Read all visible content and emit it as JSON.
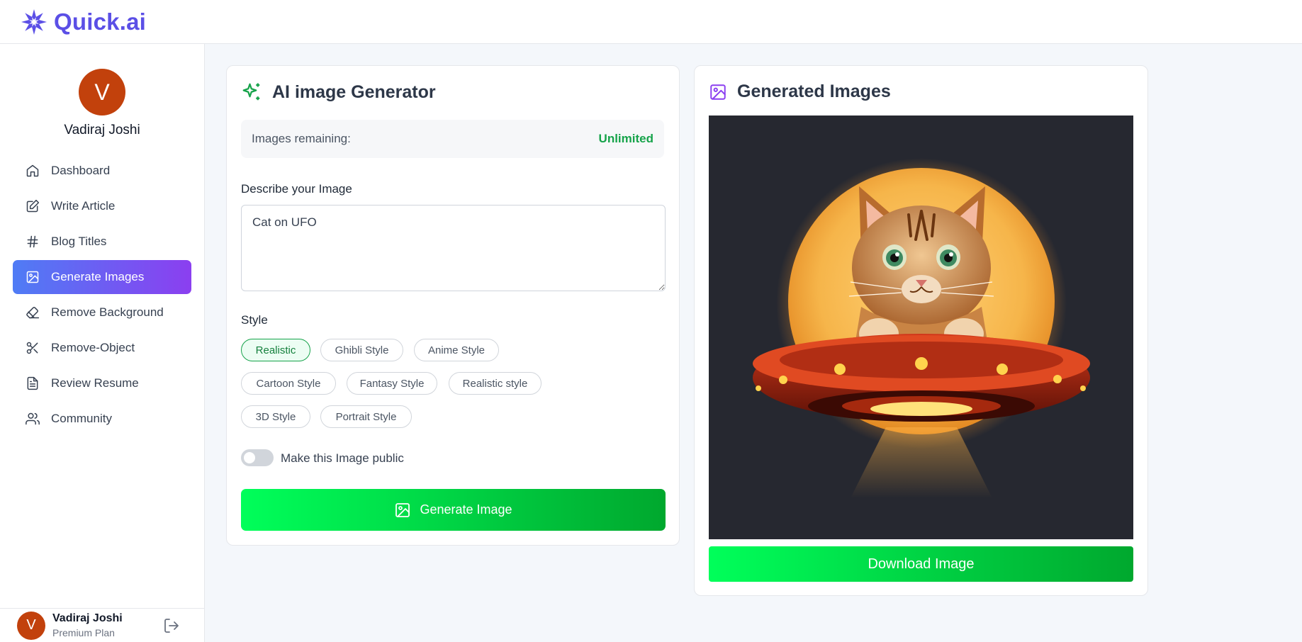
{
  "app": {
    "name": "Quick.ai",
    "brand_color": "#5b4fe6"
  },
  "user": {
    "name": "Vadiraj Joshi",
    "initial": "V",
    "plan": "Premium Plan"
  },
  "sidebar": {
    "items": [
      {
        "label": "Dashboard",
        "icon": "home-icon"
      },
      {
        "label": "Write Article",
        "icon": "edit-icon"
      },
      {
        "label": "Blog Titles",
        "icon": "hash-icon"
      },
      {
        "label": "Generate Images",
        "icon": "image-icon",
        "active": true
      },
      {
        "label": "Remove Background",
        "icon": "eraser-icon"
      },
      {
        "label": "Remove-Object",
        "icon": "scissors-icon"
      },
      {
        "label": "Review Resume",
        "icon": "file-text-icon"
      },
      {
        "label": "Community",
        "icon": "users-icon"
      }
    ],
    "active_gradient": [
      "#4f7cf5",
      "#8b3ff0"
    ]
  },
  "generator": {
    "title": "AI image Generator",
    "remaining_label": "Images remaining:",
    "remaining_value": "Unlimited",
    "describe_label": "Describe your Image",
    "prompt_value": "Cat on UFO",
    "style_label": "Style",
    "styles": [
      "Realistic",
      "Ghibli Style",
      "Anime Style",
      "Cartoon Style",
      "Fantasy Style",
      "Realistic style",
      "3D Style",
      "Portrait Style"
    ],
    "selected_style": "Realistic",
    "public_label": "Make this Image public",
    "public_enabled": false,
    "generate_label": "Generate Image",
    "accent": "#16a34a"
  },
  "output": {
    "title": "Generated Images",
    "image_subject": "cat on UFO",
    "download_label": "Download Image"
  }
}
